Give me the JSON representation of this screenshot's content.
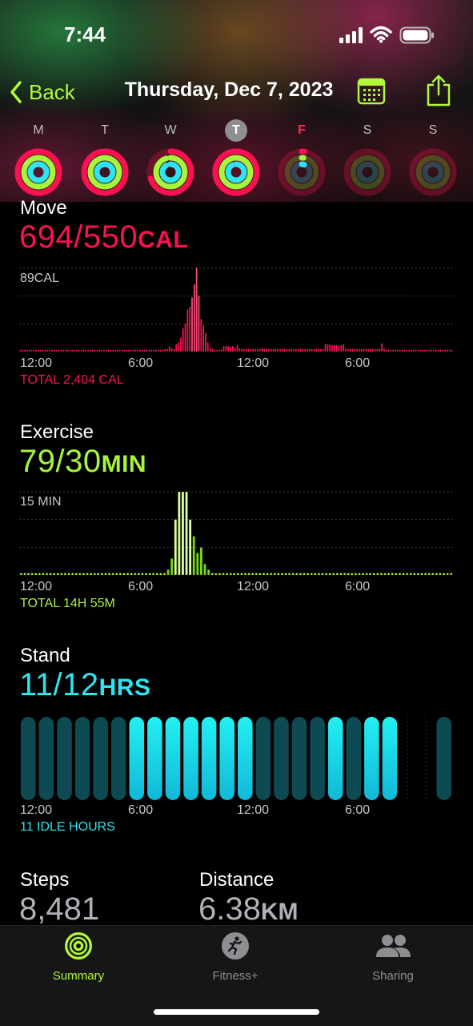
{
  "status_bar": {
    "time": "7:44"
  },
  "nav": {
    "back_label": "Back",
    "title": "Thursday, Dec 7, 2023"
  },
  "week": {
    "days": [
      "M",
      "T",
      "W",
      "T",
      "F",
      "S",
      "S"
    ],
    "today_index": 3,
    "rings": [
      {
        "move": 1.0,
        "exercise": 1.0,
        "stand": 1.0
      },
      {
        "move": 1.0,
        "exercise": 1.0,
        "stand": 1.0
      },
      {
        "move": 0.7,
        "exercise": 0.95,
        "stand": 0.9
      },
      {
        "move": 1.0,
        "exercise": 1.0,
        "stand": 0.92
      },
      {
        "move": 0.02,
        "exercise": 0.02,
        "stand": 0.05
      },
      {
        "move": 0,
        "exercise": 0,
        "stand": 0
      },
      {
        "move": 0,
        "exercise": 0,
        "stand": 0
      }
    ]
  },
  "move": {
    "title": "Move",
    "value": "694/550",
    "unit": "CAL",
    "max_label": "89CAL",
    "total": "TOTAL 2,404 CAL",
    "color": "#fa1150"
  },
  "exercise": {
    "title": "Exercise",
    "value": "79/30",
    "unit": "MIN",
    "max_label": "15 MIN",
    "total": "TOTAL 14H 55M",
    "color": "#a6f53b"
  },
  "stand": {
    "title": "Stand",
    "value": "11/12",
    "unit": "HRS",
    "total": "11 IDLE HOURS",
    "color": "#2de4f0"
  },
  "x_ticks": [
    "12:00",
    "6:00",
    "12:00",
    "6:00"
  ],
  "steps": {
    "label": "Steps",
    "value": "8,481"
  },
  "distance": {
    "label": "Distance",
    "value": "6.38",
    "unit": "KM"
  },
  "tabs": [
    {
      "label": "Summary",
      "icon": "activity-rings-icon",
      "active": true
    },
    {
      "label": "Fitness+",
      "icon": "runner-icon",
      "active": false
    },
    {
      "label": "Sharing",
      "icon": "people-icon",
      "active": false
    }
  ],
  "chart_data": [
    {
      "type": "bar",
      "title": "Move",
      "x_range": [
        0,
        24
      ],
      "x_unit": "hour",
      "ylabel": "89CAL",
      "ylim": [
        0,
        89
      ],
      "series": [
        {
          "values": [
            2,
            2,
            2,
            2,
            2,
            2,
            2,
            2,
            2,
            2,
            2,
            2,
            2,
            2,
            2,
            2,
            2,
            2,
            2,
            2,
            2,
            2,
            2,
            2,
            2,
            2,
            2,
            2,
            2,
            2,
            2,
            2,
            2,
            2,
            2,
            2,
            2,
            2,
            2,
            2,
            2,
            2,
            2,
            2,
            2,
            2,
            2,
            2,
            2,
            2,
            2,
            2,
            2,
            2,
            2,
            2,
            2,
            2,
            2,
            2,
            2,
            2,
            2,
            2,
            3,
            3,
            6,
            4,
            3,
            8,
            10,
            15,
            25,
            30,
            45,
            48,
            58,
            72,
            90,
            60,
            35,
            28,
            20,
            10,
            4,
            3,
            2,
            2,
            2,
            2,
            6,
            6,
            6,
            5,
            6,
            4,
            7,
            4,
            3,
            3,
            3,
            3,
            3,
            3,
            3,
            3,
            3,
            4,
            3,
            3,
            3,
            3,
            3,
            3,
            3,
            3,
            3,
            3,
            3,
            3,
            3,
            3,
            3,
            3,
            3,
            3,
            3,
            3,
            3,
            3,
            3,
            3,
            3,
            3,
            3,
            8,
            8,
            8,
            7,
            7,
            7,
            6,
            7,
            8,
            4,
            3,
            3,
            3,
            3,
            3,
            3,
            3,
            3,
            3,
            3,
            3,
            3,
            3,
            3,
            3,
            9,
            4,
            2,
            2,
            2,
            2,
            2,
            2,
            2,
            2,
            2,
            2,
            2,
            2,
            2,
            2,
            2,
            2,
            2,
            2,
            2,
            2,
            2,
            2,
            2,
            2,
            2,
            2,
            2,
            2,
            2,
            2
          ]
        }
      ]
    },
    {
      "type": "bar",
      "title": "Exercise",
      "x_range": [
        0,
        24
      ],
      "x_unit": "hour",
      "ylabel": "15 MIN",
      "ylim": [
        0,
        15
      ],
      "series": [
        {
          "values": [
            0.3,
            0.3,
            0.3,
            0.3,
            0.3,
            0.3,
            0.3,
            0.3,
            0.3,
            0.3,
            0.3,
            0.3,
            0.3,
            0.3,
            0.3,
            0.3,
            0.3,
            0.3,
            0.3,
            0.3,
            0.3,
            0.3,
            0.3,
            0.3,
            0.3,
            0.3,
            0.3,
            0.3,
            0.3,
            0.3,
            0.3,
            0.3,
            0.3,
            0.3,
            0.3,
            0.3,
            0.3,
            0.3,
            0.3,
            0.3,
            1,
            3,
            10,
            15,
            15,
            15,
            10,
            7,
            4,
            5,
            2,
            1,
            0.3,
            0.3,
            0.3,
            0.3,
            0.3,
            0.3,
            0.3,
            0.3,
            0.3,
            0.3,
            0.3,
            0.3,
            0.3,
            0.3,
            0.3,
            0.3,
            0.3,
            0.3,
            0.3,
            0.3,
            0.3,
            0.3,
            0.3,
            0.3,
            0.3,
            0.3,
            0.3,
            0.3,
            0.3,
            0.3,
            0.3,
            0.3,
            0.3,
            0.3,
            0.3,
            0.3,
            0.3,
            0.3,
            0.3,
            0.3,
            0.3,
            0.3,
            0.3,
            0.3,
            0.3,
            0.3,
            0.3,
            0.3,
            0.3,
            0.3,
            0.3,
            0.3,
            0.3,
            0.3,
            0.3,
            0.3,
            0.3,
            0.3,
            0.3,
            0.3,
            0.3,
            0.3,
            0.3,
            0.3,
            0.3,
            0.3
          ]
        }
      ]
    },
    {
      "type": "bar",
      "title": "Stand",
      "x_range": [
        0,
        24
      ],
      "x_unit": "hour",
      "categories": [
        "0",
        "1",
        "2",
        "3",
        "4",
        "5",
        "6",
        "7",
        "8",
        "9",
        "10",
        "11",
        "12",
        "13",
        "14",
        "15",
        "16",
        "17",
        "18",
        "19",
        "20",
        "21",
        "22",
        "23"
      ],
      "series": [
        {
          "name": "stood",
          "values": [
            0,
            0,
            0,
            0,
            0,
            0,
            1,
            1,
            1,
            1,
            1,
            1,
            1,
            0,
            0,
            0,
            0,
            1,
            0,
            1,
            1,
            0,
            0,
            0
          ]
        },
        {
          "name": "idle",
          "values": [
            1,
            1,
            1,
            1,
            1,
            1,
            0,
            0,
            0,
            0,
            0,
            0,
            0,
            1,
            1,
            1,
            1,
            0,
            1,
            0,
            0,
            0,
            0,
            1
          ]
        }
      ]
    }
  ]
}
